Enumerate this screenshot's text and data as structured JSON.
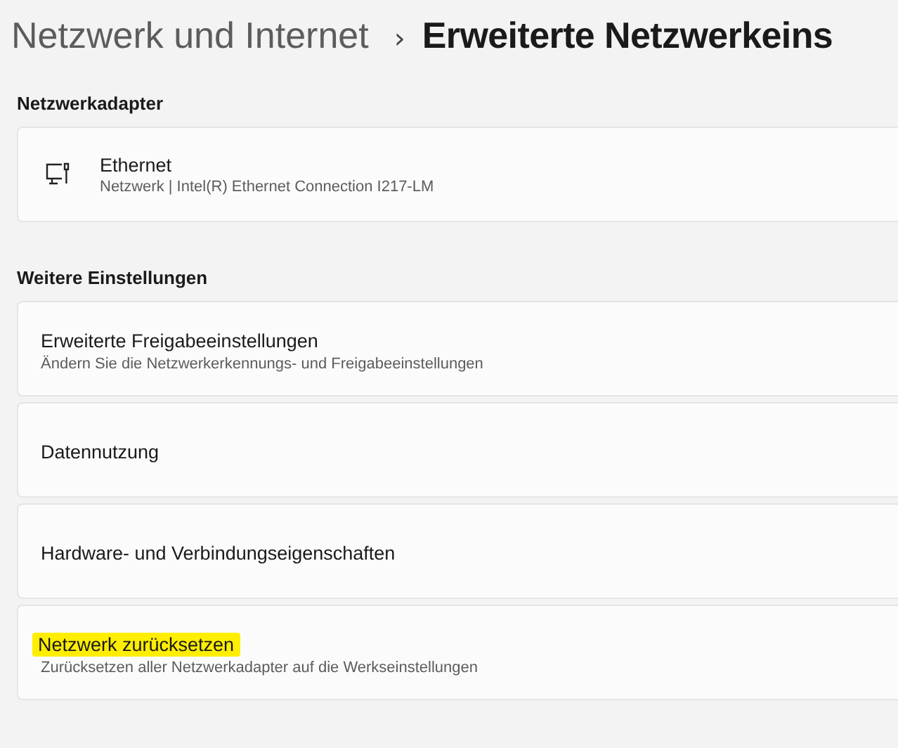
{
  "breadcrumb": {
    "parent": "Netzwerk und Internet",
    "separator": "›",
    "current": "Erweiterte Netzwerkeins"
  },
  "adapters": {
    "heading": "Netzwerkadapter",
    "items": [
      {
        "title": "Ethernet",
        "subtitle": "Netzwerk | Intel(R) Ethernet Connection I217-LM"
      }
    ]
  },
  "more_settings": {
    "heading": "Weitere Einstellungen",
    "items": [
      {
        "title": "Erweiterte Freigabeeinstellungen",
        "subtitle": "Ändern Sie die Netzwerkerkennungs- und Freigabeeinstellungen",
        "highlighted": false
      },
      {
        "title": "Datennutzung",
        "highlighted": false
      },
      {
        "title": "Hardware- und Verbindungseigenschaften",
        "highlighted": false
      },
      {
        "title": "Netzwerk zurücksetzen",
        "subtitle": "Zurücksetzen aller Netzwerkadapter auf die Werkseinstellungen",
        "highlighted": true
      }
    ]
  }
}
